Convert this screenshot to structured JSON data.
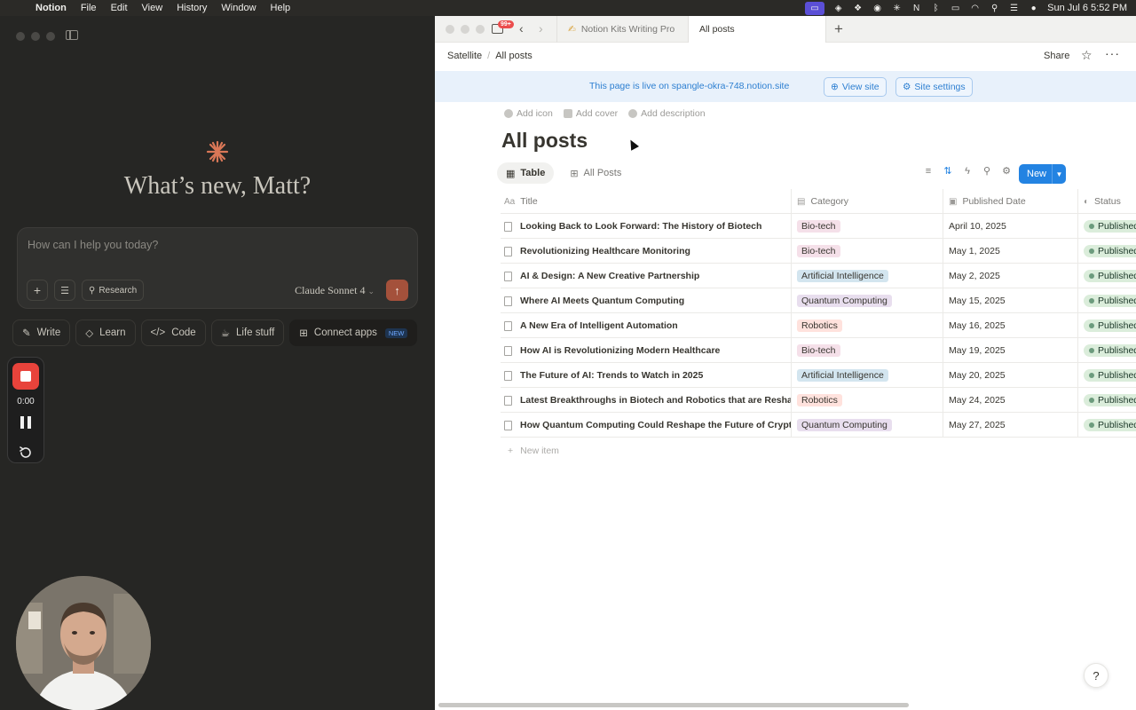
{
  "menubar": {
    "app": "Notion",
    "items": [
      "File",
      "Edit",
      "View",
      "History",
      "Window",
      "Help"
    ],
    "clock": "Sun Jul 6  5:52 PM",
    "icons": [
      "screen-share-icon",
      "dropbox-icon",
      "grammarly-icon",
      "claude-icon",
      "notion-icon",
      "bluetooth-icon",
      "battery-icon",
      "wifi-icon",
      "spotlight-icon",
      "control-center-icon",
      "siri-icon"
    ]
  },
  "claude": {
    "greeting": "What’s new, Matt?",
    "composer_placeholder": "How can I help you today?",
    "research_label": "Research",
    "model": "Claude Sonnet 4",
    "chips": [
      {
        "label": "Write",
        "icon": "pencil-icon"
      },
      {
        "label": "Learn",
        "icon": "graduation-cap-icon"
      },
      {
        "label": "Code",
        "icon": "code-icon"
      },
      {
        "label": "Life stuff",
        "icon": "coffee-icon"
      }
    ],
    "connect_apps": {
      "label": "Connect apps",
      "badge": "NEW"
    },
    "accent": "#d97757"
  },
  "recorder": {
    "time": "0:00"
  },
  "notion": {
    "tabs": {
      "badge": "99+",
      "items": [
        {
          "label": "Notion Kits Writing Pro",
          "active": false
        },
        {
          "label": "All posts",
          "active": true
        }
      ]
    },
    "breadcrumb": {
      "workspace": "Satellite",
      "page": "All posts"
    },
    "share_label": "Share",
    "banner": {
      "text": "This page is live on spangle-okra-748.notion.site",
      "view_site": "View site",
      "site_settings": "Site settings"
    },
    "page_actions": {
      "add_icon": "Add icon",
      "add_cover": "Add cover",
      "add_description": "Add description"
    },
    "title": "All posts",
    "views": [
      {
        "label": "Table",
        "active": true
      },
      {
        "label": "All Posts",
        "active": false
      }
    ],
    "new_button": "New",
    "columns": {
      "title": "Title",
      "category": "Category",
      "published": "Published Date",
      "status": "Status"
    },
    "rows": [
      {
        "title": "Looking Back to Look Forward: The History of Biotech",
        "category": "Bio-tech",
        "date": "April 10, 2025",
        "status": "Published"
      },
      {
        "title": "Revolutionizing Healthcare Monitoring",
        "category": "Bio-tech",
        "date": "May 1, 2025",
        "status": "Published"
      },
      {
        "title": "AI & Design: A New Creative Partnership",
        "category": "Artificial Intelligence",
        "date": "May 2, 2025",
        "status": "Published"
      },
      {
        "title": "Where AI Meets Quantum Computing",
        "category": "Quantum Computing",
        "date": "May 15, 2025",
        "status": "Published"
      },
      {
        "title": "A New Era of Intelligent Automation",
        "category": "Robotics",
        "date": "May 16, 2025",
        "status": "Published"
      },
      {
        "title": "How AI is Revolutionizing Modern Healthcare",
        "category": "Bio-tech",
        "date": "May 19, 2025",
        "status": "Published"
      },
      {
        "title": "The Future of AI: Trends to Watch in 2025",
        "category": "Artificial Intelligence",
        "date": "May 20, 2025",
        "status": "Published"
      },
      {
        "title": "Latest Breakthroughs in Biotech and Robotics that are Reshaping",
        "category": "Robotics",
        "date": "May 24, 2025",
        "status": "Published"
      },
      {
        "title": "How Quantum Computing Could Reshape the Future of Cryptography",
        "category": "Quantum Computing",
        "date": "May 27, 2025",
        "status": "Published"
      }
    ],
    "new_item": "New item",
    "colors": {
      "accent": "#2383e2",
      "bio_tag": "#f5e0e9",
      "ai_tag": "#d3e5ef",
      "qc_tag": "#e8deee",
      "robotics_tag": "#ffe2dd",
      "published": "#dbeddb"
    }
  }
}
